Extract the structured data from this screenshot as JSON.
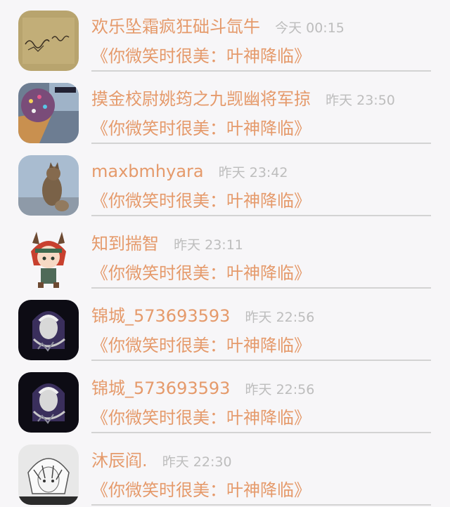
{
  "messages": [
    {
      "name": "欢乐坠霜疯狂础斗氙牛",
      "time": "今天 00:15",
      "preview": "《你微笑时很美：叶神降临》",
      "avatar": "handwriting-avatar"
    },
    {
      "name": "摸金校尉姚筠之九觊幽将军掠",
      "time": "昨天 23:50",
      "preview": "《你微笑时很美：叶神降临》",
      "avatar": "ice-cream-avatar"
    },
    {
      "name": "maxbmhyara",
      "time": "昨天 23:42",
      "preview": "《你微笑时很美：叶神降临》",
      "avatar": "cat-avatar"
    },
    {
      "name": "知到揣智",
      "time": "昨天 23:11",
      "preview": "《你微笑时很美：叶神降临》",
      "avatar": "chibi-avatar"
    },
    {
      "name": "锦城_573693593",
      "time": "昨天 22:56",
      "preview": "《你微笑时很美：叶神降临》",
      "avatar": "dark-anime-avatar"
    },
    {
      "name": "锦城_573693593",
      "time": "昨天 22:56",
      "preview": "《你微笑时很美：叶神降临》",
      "avatar": "dark-anime-avatar"
    },
    {
      "name": "沐辰阎.",
      "time": "昨天 22:30",
      "preview": "《你微笑时很美：叶神降临》",
      "avatar": "sketch-anime-avatar"
    }
  ]
}
